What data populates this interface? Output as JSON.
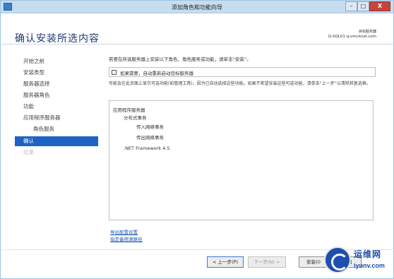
{
  "window": {
    "title": "添加角色和功能向导",
    "controls": {
      "minimize": "–",
      "maximize": "□",
      "close": "X"
    }
  },
  "header": {
    "page_title": "确认安装所选内容",
    "target_server_label": "目标服务器",
    "target_server_value": "Q-SQL01.q-vmcloud.com"
  },
  "sidebar": {
    "items": [
      {
        "label": "开始之前",
        "state": "normal"
      },
      {
        "label": "安装类型",
        "state": "normal"
      },
      {
        "label": "服务器选择",
        "state": "normal"
      },
      {
        "label": "服务器角色",
        "state": "normal"
      },
      {
        "label": "功能",
        "state": "normal"
      },
      {
        "label": "应用程序服务器",
        "state": "normal"
      },
      {
        "label": "角色服务",
        "state": "normal"
      },
      {
        "label": "确认",
        "state": "active"
      },
      {
        "label": "结果",
        "state": "disabled"
      }
    ]
  },
  "content": {
    "intro": "若要在所选服务器上安装以下角色、角色服务或功能，请单击“安装”。",
    "restart_checkbox": {
      "label": "如果需要，自动重新启动目标服务器",
      "checked": false
    },
    "note": "可能会在此页面上显示可选功能(如管理工具)，因为已自动选择这些功能。如果不希望安装这些可选功能，请单击“上一步”以清除其复选框。",
    "selections": [
      "应用程序服务器",
      "分布式事务",
      "传入网络事务",
      "传出网络事务",
      ".NET Framework 4.5"
    ],
    "links": {
      "export": "导出配置设置",
      "alternate_source": "指定备用源路径"
    }
  },
  "footer": {
    "prev": "< 上一步(P)",
    "next": "下一步(N) >",
    "install": "安装(I)",
    "cancel": "取消"
  },
  "watermark": {
    "text_cn": "运维网",
    "url": "iyunv.com"
  },
  "colors": {
    "accent": "#1e63c4",
    "title_text": "#1e3a72",
    "link": "#1a55b5",
    "titlebar": "#c6dcef",
    "close_button": "#c7443b"
  }
}
